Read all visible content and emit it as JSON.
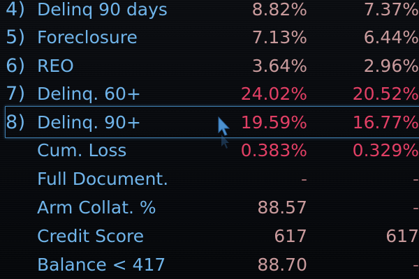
{
  "rows": [
    {
      "index": "4)",
      "label": "Delinq 90 days",
      "value1": "8.82%",
      "value2": "7.37%"
    },
    {
      "index": "5)",
      "label": "Foreclosure",
      "value1": "7.13%",
      "value2": "6.44%"
    },
    {
      "index": "6)",
      "label": "REO",
      "value1": "3.64%",
      "value2": "2.96%"
    },
    {
      "index": "7)",
      "label": "Delinq. 60+",
      "value1": "24.02%",
      "value2": "20.52%"
    },
    {
      "index": "8)",
      "label": "Delinq. 90+",
      "value1": "19.59%",
      "value2": "16.77%"
    },
    {
      "index": "",
      "label": "Cum. Loss",
      "value1": "0.383%",
      "value2": "0.329%"
    },
    {
      "index": "",
      "label": "Full Document.",
      "value1": "-",
      "value2": "-"
    },
    {
      "index": "",
      "label": "Arm Collat. %",
      "value1": "88.57",
      "value2": "-"
    },
    {
      "index": "",
      "label": "Credit Score",
      "value1": "617",
      "value2": "617"
    },
    {
      "index": "",
      "label": "Balance < 417",
      "value1": "88.70",
      "value2": "-"
    }
  ],
  "colors": {
    "label": "#6fb4ea",
    "value_muted": "#c99a9c",
    "value_hot": "#e23e64",
    "selection_border": "#3f7fb0",
    "background": "#07090d"
  },
  "cursor_icon": "mouse-pointer-icon"
}
